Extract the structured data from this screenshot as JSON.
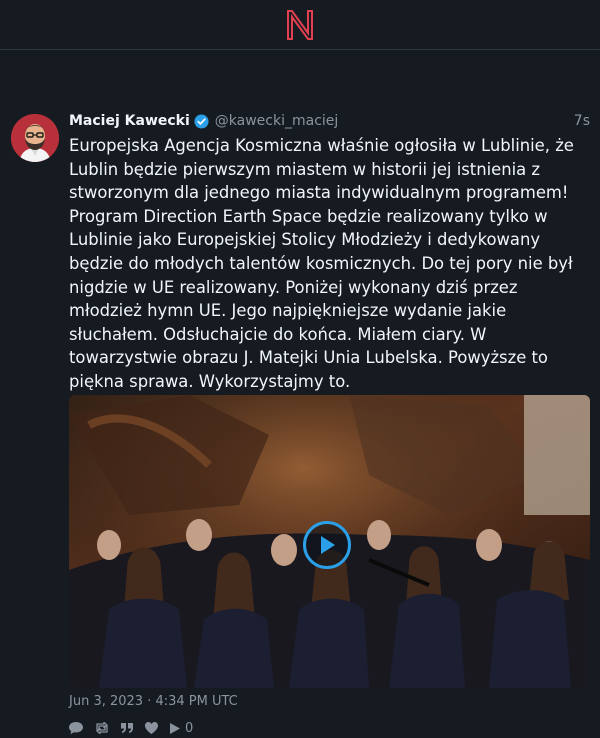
{
  "logo": "N",
  "tweet": {
    "fullname": "Maciej Kawecki",
    "username": "@kawecki_maciej",
    "time": "7s",
    "text": "Europejska Agencja Kosmiczna właśnie ogłosiła w Lublinie, że Lublin będzie pierwszym miastem w historii jej istnienia z stworzonym dla jednego miasta indywidualnym programem! Program Direction Earth Space będzie realizowany tylko w Lublinie jako Europejskiej Stolicy Młodzieży i dedykowany będzie do młodych talentów kosmicznych. Do tej pory nie był nigdzie w UE realizowany. Poniżej wykonany dziś przez młodzież hymn UE. Jego najpiękniejsze wydanie jakie słuchałem. Odsłuchajcie do końca. Miałem ciary. W towarzystwie obrazu J. Matejki Unia Lubelska. Powyższe to piękna sprawa. Wykorzystajmy to.",
    "date": "Jun 3, 2023 · 4:34 PM UTC",
    "media": {
      "type": "video"
    },
    "stats": {
      "replies_icon": "comment-icon",
      "retweets_icon": "retweet-icon",
      "quotes_icon": "quote-icon",
      "likes_icon": "heart-icon",
      "plays_icon": "play-icon",
      "plays": "0"
    }
  },
  "colors": {
    "background": "#161b22",
    "text": "#f0f6fc",
    "muted": "#8b949e",
    "logo": "#e2404f",
    "accent": "#2ba0e8",
    "divider": "#30363d"
  }
}
